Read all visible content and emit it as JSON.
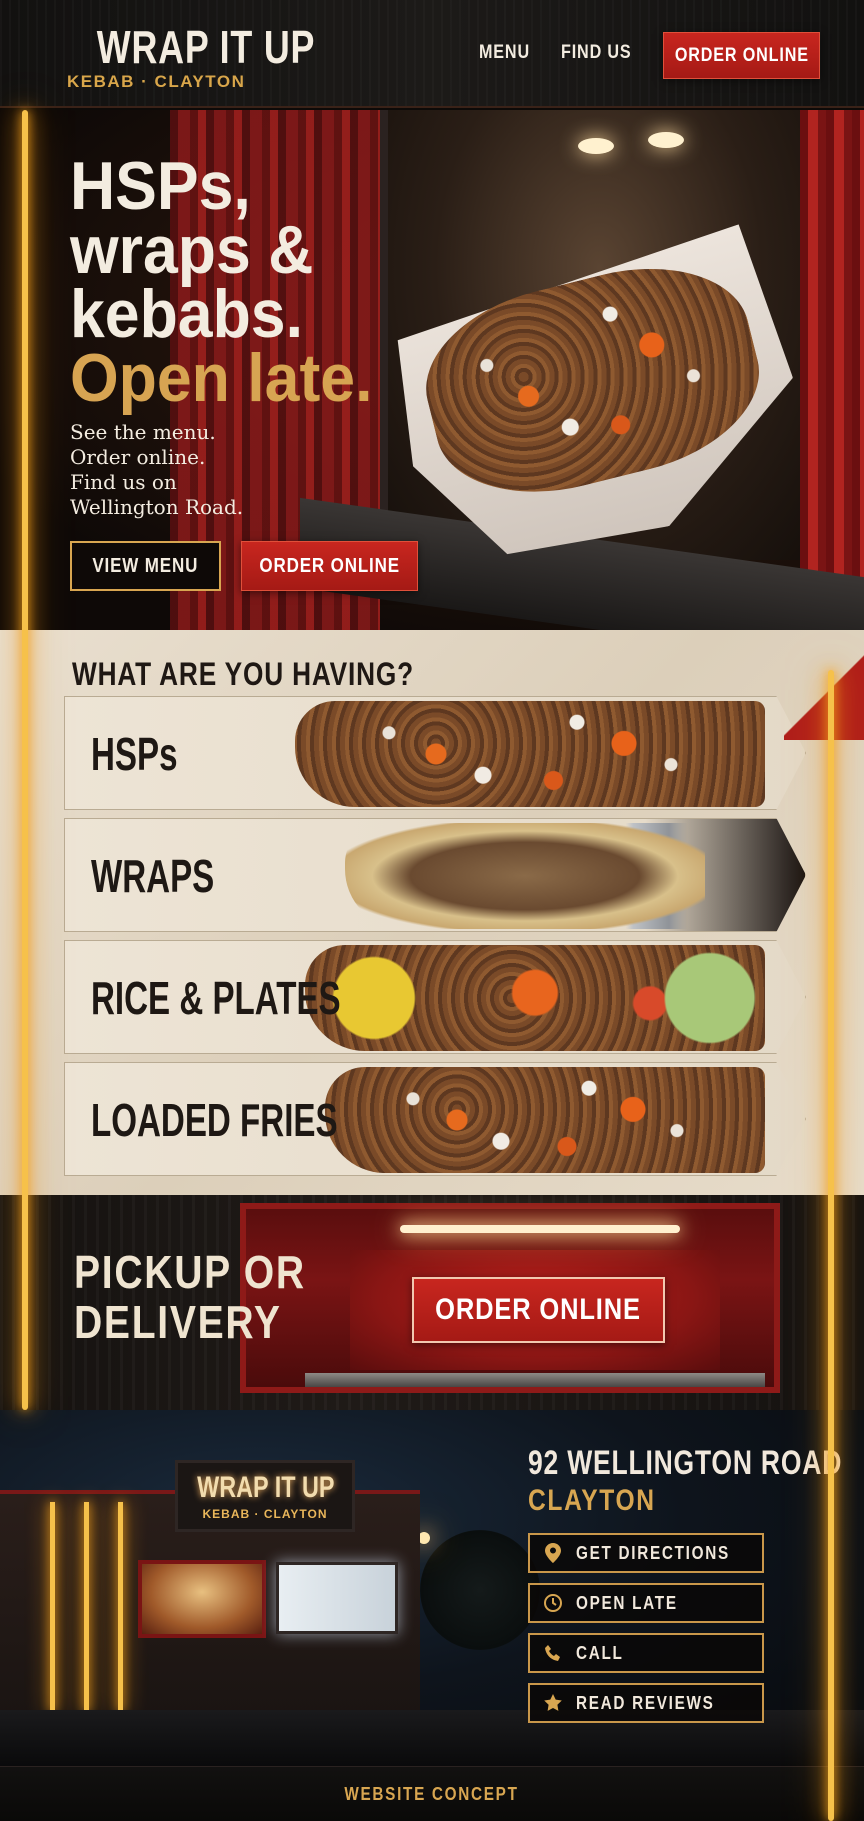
{
  "header": {
    "logo_title": "WRAP IT UP",
    "logo_subtitle": "KEBAB · CLAYTON",
    "nav": [
      "MENU",
      "FIND US"
    ],
    "order_button": "ORDER ONLINE"
  },
  "hero": {
    "headline_lines": [
      "HSPs,",
      "wraps &",
      "kebabs."
    ],
    "headline_accent": "Open late.",
    "body_lines": [
      "See the menu.",
      "Order online.",
      "Find us on",
      "Wellington Road."
    ],
    "view_menu_button": "VIEW MENU",
    "order_button": "ORDER ONLINE"
  },
  "menu": {
    "title": "WHAT ARE YOU HAVING?",
    "items": [
      {
        "label": "HSPs"
      },
      {
        "label": "WRAPS"
      },
      {
        "label": "RICE & PLATES"
      },
      {
        "label": "LOADED FRIES"
      }
    ]
  },
  "pickup": {
    "title_lines": [
      "PICKUP OR",
      "DELIVERY"
    ],
    "order_button": "ORDER ONLINE"
  },
  "shop_sign": {
    "title": "WRAP IT UP",
    "subtitle": "KEBAB · CLAYTON"
  },
  "location": {
    "address_line1": "92 WELLINGTON ROAD",
    "address_line2": "CLAYTON",
    "actions": [
      {
        "label": "GET DIRECTIONS",
        "icon": "map-pin-icon"
      },
      {
        "label": "OPEN LATE",
        "icon": "clock-icon"
      },
      {
        "label": "CALL",
        "icon": "phone-icon"
      },
      {
        "label": "READ REVIEWS",
        "icon": "star-icon"
      }
    ]
  },
  "footer": {
    "text": "WEBSITE CONCEPT"
  },
  "colors": {
    "accent_gold": "#d8a651",
    "brand_red": "#b8201c",
    "neon": "#f6c14a"
  }
}
